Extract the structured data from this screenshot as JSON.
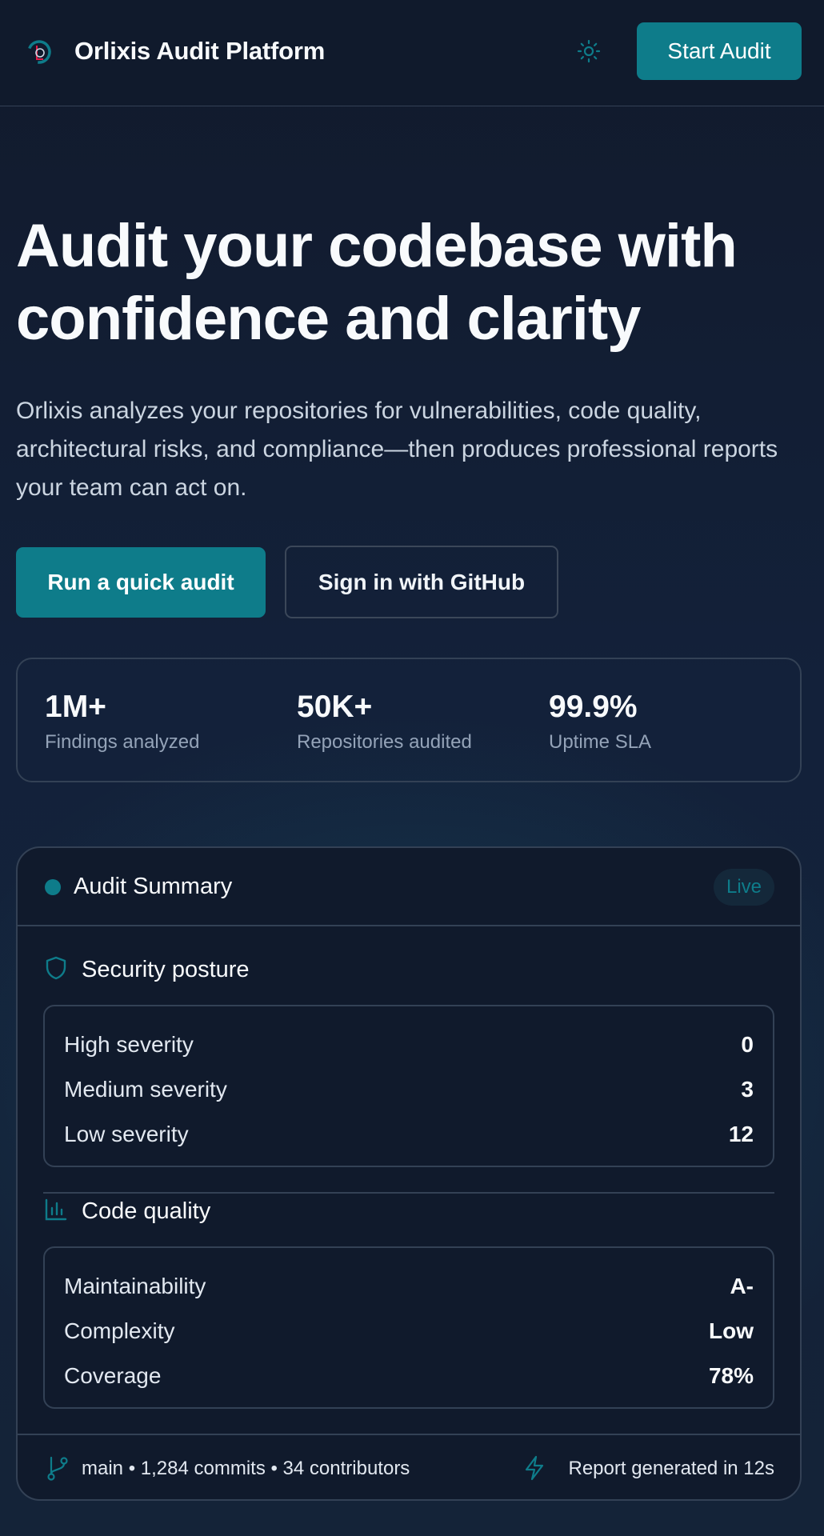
{
  "header": {
    "brand": "Orlixis Audit Platform",
    "logo_icon": "orlixis-logo-icon",
    "theme_icon": "sun-icon",
    "start_button": "Start Audit"
  },
  "hero": {
    "headline_line1": "Audit your codebase with",
    "headline_line2": "confidence and clarity",
    "subtext": "Orlixis analyzes your repositories for vulnerabilities, code quality, architectural risks, and compliance—then produces professional reports your team can act on.",
    "primary_button": "Run a quick audit",
    "secondary_button": "Sign in with GitHub"
  },
  "stats": [
    {
      "value": "1M+",
      "label": "Findings analyzed"
    },
    {
      "value": "50K+",
      "label": "Repositories audited"
    },
    {
      "value": "99.9%",
      "label": "Uptime SLA"
    }
  ],
  "summary": {
    "title": "Audit Summary",
    "badge": "Live",
    "security": {
      "title": "Security posture",
      "icon": "shield-icon",
      "rows": [
        {
          "label": "High severity",
          "value": "0"
        },
        {
          "label": "Medium severity",
          "value": "3"
        },
        {
          "label": "Low severity",
          "value": "12"
        }
      ]
    },
    "quality": {
      "title": "Code quality",
      "icon": "bar-chart-icon",
      "rows": [
        {
          "label": "Maintainability",
          "value": "A-"
        },
        {
          "label": "Complexity",
          "value": "Low"
        },
        {
          "label": "Coverage",
          "value": "78%"
        }
      ]
    },
    "footer": {
      "branch_info": "main • 1,284 commits • 34 contributors",
      "report_info": "Report generated in 12s"
    }
  },
  "colors": {
    "accent": "#0e7c8a",
    "background": "#111a2c",
    "border": "#334155",
    "muted_text": "#94a3b8"
  }
}
